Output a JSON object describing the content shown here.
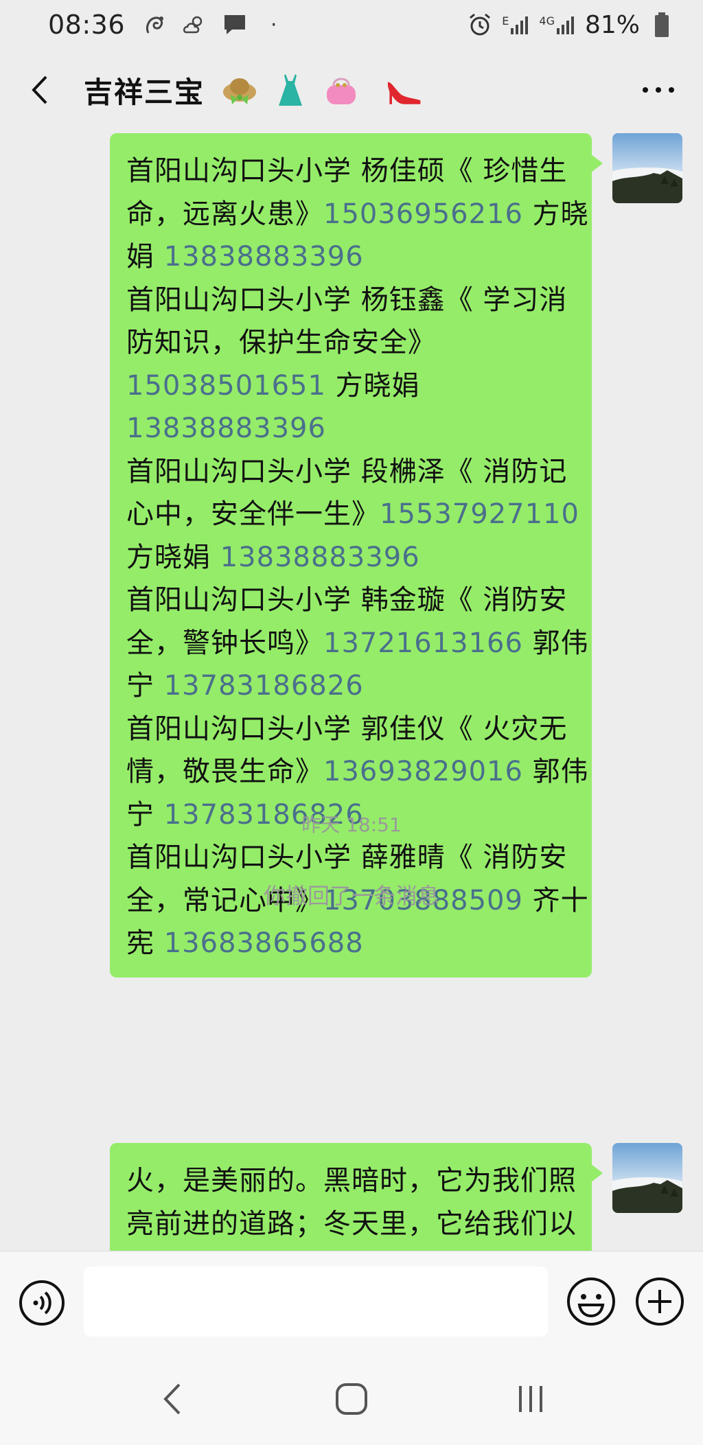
{
  "status_bar": {
    "time": "08:36",
    "icons": [
      "squirrel-browser-icon",
      "weather-icon",
      "message-icon"
    ],
    "dot": "·",
    "network": "E",
    "network2": "4G",
    "battery": "81%"
  },
  "header": {
    "title": "吉祥三宝",
    "emojis": [
      "hat-emoji",
      "dress-emoji",
      "purse-emoji",
      "high-heel-emoji"
    ]
  },
  "messages": {
    "m1": {
      "lines": [
        [
          {
            "t": "首阳山沟口头小学 杨佳硕《 珍惜生"
          }
        ],
        [
          {
            "t": "命，远离火患》"
          },
          {
            "t": "15036956216",
            "phone": true
          },
          {
            "t": " 方晓"
          }
        ],
        [
          {
            "t": "娟 "
          },
          {
            "t": "13838883396",
            "phone": true
          }
        ],
        [
          {
            "t": "首阳山沟口头小学 杨钰鑫《 学习消"
          }
        ],
        [
          {
            "t": "防知识，保护生命安全》"
          }
        ],
        [
          {
            "t": "15038501651",
            "phone": true
          },
          {
            "t": " 方晓娟"
          }
        ],
        [
          {
            "t": "13838883396",
            "phone": true
          }
        ],
        [
          {
            "t": "首阳山沟口头小学 段梻泽《 消防记"
          }
        ],
        [
          {
            "t": "心中，安全伴一生》"
          },
          {
            "t": "15537927110",
            "phone": true
          }
        ],
        [
          {
            "t": "方晓娟 "
          },
          {
            "t": "13838883396",
            "phone": true
          }
        ],
        [
          {
            "t": "首阳山沟口头小学 韩金璇《 消防安"
          }
        ],
        [
          {
            "t": "全，警钟长鸣》"
          },
          {
            "t": "13721613166",
            "phone": true
          },
          {
            "t": " 郭伟"
          }
        ],
        [
          {
            "t": "宁 "
          },
          {
            "t": "13783186826",
            "phone": true
          }
        ],
        [
          {
            "t": "首阳山沟口头小学 郭佳仪《 火灾无"
          }
        ],
        [
          {
            "t": "情，敬畏生命》"
          },
          {
            "t": "13693829016",
            "phone": true
          },
          {
            "t": " 郭伟"
          }
        ],
        [
          {
            "t": "宁 "
          },
          {
            "t": "13783186826",
            "phone": true
          }
        ],
        [
          {
            "t": "首阳山沟口头小学 薛雅晴《 消防安"
          }
        ],
        [
          {
            "t": "全，常记心中》"
          },
          {
            "t": "13703888509",
            "phone": true
          },
          {
            "t": " 齐十"
          }
        ],
        [
          {
            "t": "宪 "
          },
          {
            "t": "13683865688",
            "phone": true
          }
        ]
      ]
    },
    "timestamp": "昨天 18:51",
    "recall_notice": "你撤回了一条消息",
    "m2": {
      "lines": [
        [
          {
            "t": "火，是美丽的。黑暗时，它为我们照"
          }
        ],
        [
          {
            "t": "亮前进的道路；冬天里，它给我们以"
          }
        ]
      ]
    }
  },
  "input_bar": {
    "placeholder": "",
    "left_icon": "voice-icon",
    "right_icons": [
      "emoji-icon",
      "plus-icon"
    ]
  },
  "nav_bar": {
    "icons": [
      "back-nav-icon",
      "home-nav-icon",
      "recents-nav-icon"
    ]
  }
}
